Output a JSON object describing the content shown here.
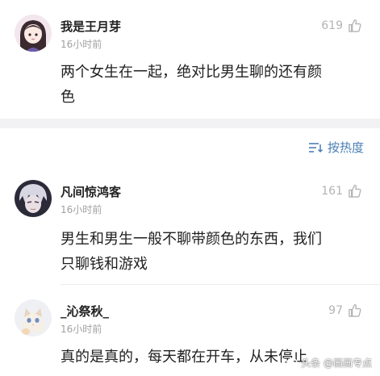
{
  "comments_top": {
    "user": "我是王月芽",
    "time": "16小时前",
    "likes": "619",
    "lines": [
      "两个女生在一起，绝对比男生聊的还有颜",
      "色"
    ]
  },
  "sort": {
    "label": "按热度"
  },
  "comments": [
    {
      "user": "凡间惊鸿客",
      "time": "16小时前",
      "likes": "161",
      "lines": [
        "男生和男生一般不聊带颜色的东西，我们",
        "只聊钱和游戏"
      ]
    },
    {
      "user": "_沁祭秋_",
      "time": "16小时前",
      "likes": "97",
      "lines": [
        "真的是真的，每天都在开车，从未停止"
      ]
    }
  ],
  "watermark": {
    "text": "头条 @画画专点"
  },
  "colors": {
    "link": "#4a7fb5",
    "muted": "#a0a0a0",
    "band": "#f2f2f4"
  }
}
